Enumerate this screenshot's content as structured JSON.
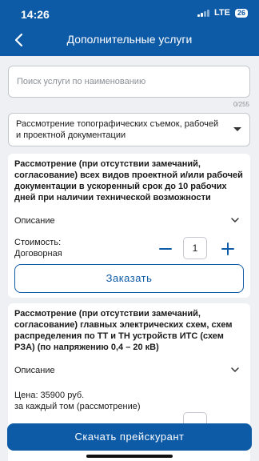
{
  "status": {
    "time": "14:26",
    "network": "LTE",
    "battery": "26"
  },
  "header": {
    "title": "Дополнительные услуги",
    "back_icon": "chevron-left-icon"
  },
  "search": {
    "placeholder": "Поиск услуги по наименованию",
    "value": "",
    "counter": "0/255"
  },
  "category_select": {
    "selected": "Рассмотрение топографических съемок, рабочей и проектной документации"
  },
  "services": [
    {
      "title": "Рассмотрение (при отсутствии замечаний, согласование) всех видов проектной и/или рабочей документации в ускоренный срок до 10 рабочих дней при наличии технической возможности",
      "description_label": "Описание",
      "price_line1": "Стоимость:",
      "price_line2": "Договорная",
      "quantity": "1",
      "order_label": "Заказать"
    },
    {
      "title": "Рассмотрение (при отсутствии замечаний, согласование) главных электрических схем, схем распределения по ТТ и ТН устройств ИТС (схем РЗА) (по напряжению 0,4 – 20 кВ)",
      "description_label": "Описание",
      "price_line1": "Цена: 35900 руб.",
      "price_line2": "за каждый том (рассмотрение)"
    }
  ],
  "footer": {
    "download_label": "Скачать прейскурант"
  },
  "colors": {
    "primary": "#0d5aa7",
    "background": "#eef0f4"
  }
}
